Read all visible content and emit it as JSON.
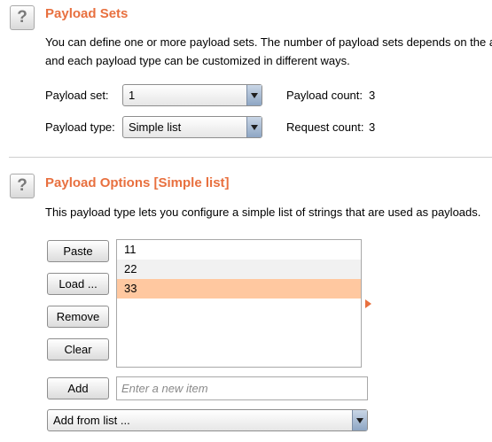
{
  "sets": {
    "title": "Payload Sets",
    "description_line1": "You can define one or more payload sets. The number of payload sets depends on the a",
    "description_line2": "and each payload type can be customized in different ways.",
    "payload_set_label": "Payload set:",
    "payload_set_value": "1",
    "payload_count_label": "Payload count:",
    "payload_count_value": "3",
    "payload_type_label": "Payload type:",
    "payload_type_value": "Simple list",
    "request_count_label": "Request count:",
    "request_count_value": "3"
  },
  "options": {
    "title": "Payload Options [Simple list]",
    "description": "This payload type lets you configure a simple list of strings that are used as payloads.",
    "buttons": {
      "paste": "Paste",
      "load": "Load ...",
      "remove": "Remove",
      "clear": "Clear",
      "add": "Add"
    },
    "items": [
      "11",
      "22",
      "33"
    ],
    "selected_item": "33",
    "new_item_placeholder": "Enter a new item",
    "add_from_list": "Add from list ..."
  },
  "help_glyph": "?",
  "colors": {
    "accent": "#e8703f",
    "selection": "#ffc8a0"
  }
}
